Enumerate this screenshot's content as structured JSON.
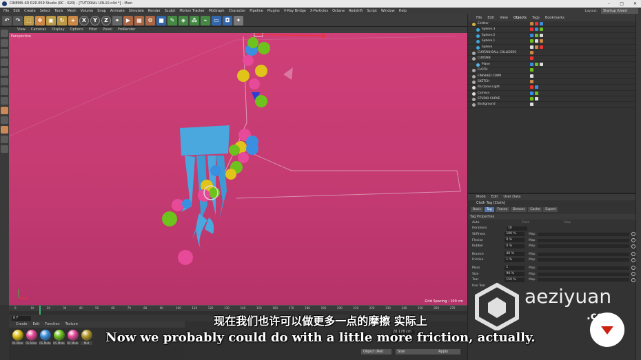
{
  "window": {
    "title": "CINEMA 4D R20.059 Studio (RC - R20) - [TUTORIAL U3L10.c4d *] - Main"
  },
  "menubar": {
    "items": [
      "File",
      "Edit",
      "Create",
      "Select",
      "Tools",
      "Mesh",
      "Volume",
      "Snap",
      "Animate",
      "Simulate",
      "Render",
      "Sculpt",
      "Motion Tracker",
      "MoGraph",
      "Character",
      "Pipeline",
      "Plugins",
      "V-Ray Bridge",
      "X-Particles",
      "Octane",
      "Redshift",
      "Script",
      "Window",
      "Help"
    ],
    "layout_label": "Layout:",
    "layout_value": "Startup (User)"
  },
  "toolbar": {
    "axis_labels": [
      "X",
      "Y",
      "Z"
    ]
  },
  "viewport": {
    "menu": [
      "View",
      "Cameras",
      "Display",
      "Options",
      "Filter",
      "Panel",
      "ProRender"
    ],
    "label": "Perspective",
    "grid_spacing": "Grid Spacing : 100 cm",
    "colors": {
      "background": "#c83d75",
      "cloth": "#4aa8de",
      "sphere_yellow": "#e0c419",
      "sphere_green": "#6ec21e",
      "sphere_blue": "#3b8fe0",
      "sphere_pink": "#e84a9a"
    }
  },
  "timeline": {
    "ticks": [
      "0",
      "10",
      "20",
      "30",
      "40",
      "50",
      "60",
      "70",
      "80",
      "90",
      "100",
      "110",
      "120",
      "130",
      "140",
      "150",
      "160",
      "170",
      "180",
      "190",
      "200",
      "210",
      "220",
      "230",
      "240",
      "250",
      "260",
      "270"
    ],
    "current_frame_field": "0 F",
    "end_field": "270 F"
  },
  "materials": {
    "menu": [
      "Create",
      "Edit",
      "Function",
      "Texture"
    ],
    "items": [
      {
        "label": "RS Mate",
        "color": "#e0c419"
      },
      {
        "label": "RS Mate",
        "color": "#e84a9a"
      },
      {
        "label": "RS Mate",
        "color": "#3b8fe0"
      },
      {
        "label": "RS Mate",
        "color": "#6ec21e"
      },
      {
        "label": "RS Mate",
        "color": "#e84a9a"
      },
      {
        "label": "Mat",
        "color": "#b59a2a"
      }
    ]
  },
  "coordinates": {
    "mode": "Object (Rel)",
    "size_mode": "Size",
    "apply": "Apply",
    "x_size_value": "28.178 cm"
  },
  "object_manager": {
    "tabs": [
      "File",
      "Edit",
      "View",
      "Objects",
      "Tags",
      "Bookmarks"
    ],
    "rows": [
      {
        "name": "Emitter",
        "color": "#d8b33c"
      },
      {
        "name": "Sphere.3",
        "color": "#3fa9e0"
      },
      {
        "name": "Sphere.2",
        "color": "#3fa9e0"
      },
      {
        "name": "Sphere.1",
        "color": "#3fa9e0"
      },
      {
        "name": "Sphere",
        "color": "#3fa9e0"
      },
      {
        "name": "CURTAIN BALL COLLIDERS",
        "color": "#aaaaaa"
      },
      {
        "name": "CURTAIN",
        "color": "#aaaaaa"
      },
      {
        "name": "Plane",
        "color": "#5bb4e6"
      },
      {
        "name": "CLOTH",
        "color": "#aaaaaa"
      },
      {
        "name": "FINISHED COMP",
        "color": "#aaaaaa"
      },
      {
        "name": "SKETCH",
        "color": "#aaaaaa"
      },
      {
        "name": "RS Dome Light",
        "color": "#dddddd"
      },
      {
        "name": "Camera",
        "color": "#dddddd"
      },
      {
        "name": "STUDIO CURVE",
        "color": "#aaaaaa"
      },
      {
        "name": "Background",
        "color": "#aaaaaa"
      }
    ]
  },
  "attribute_manager": {
    "tabs": [
      "Mode",
      "Edit",
      "User Data"
    ],
    "tag_title": "Cloth Tag [Cloth]",
    "subtabs": [
      "Basic",
      "Tag",
      "Forces",
      "Dresser",
      "Cache",
      "Expert"
    ],
    "section": "Tag Properties",
    "auto_label": "Auto",
    "start_label": "Start",
    "stop_label": "Stop",
    "properties": [
      {
        "label": "Iterations",
        "value": "10",
        "map": false
      },
      {
        "label": "Stiffness",
        "value": "100 %",
        "map": true
      },
      {
        "label": "Flexion",
        "value": "0 %",
        "map": true
      },
      {
        "label": "Rubber",
        "value": "0 %",
        "map": true
      },
      {
        "label": "Bounce",
        "value": "40 %",
        "map": true
      },
      {
        "label": "Friction",
        "value": "1 %",
        "map": true
      },
      {
        "label": "Mass",
        "value": "1",
        "map": true
      },
      {
        "label": "Size",
        "value": "90 %",
        "map": true
      },
      {
        "label": "Tear",
        "value": "150 %",
        "map": true
      },
      {
        "label": "Use Tear",
        "value": "",
        "map": false
      }
    ]
  },
  "subtitles": {
    "zh": "现在我们也许可以做更多一点的摩擦 实际上",
    "en": "Now we probably could do with a little more friction, actually."
  },
  "watermark": {
    "text": "aeziyuan",
    "suffix": ".com"
  }
}
